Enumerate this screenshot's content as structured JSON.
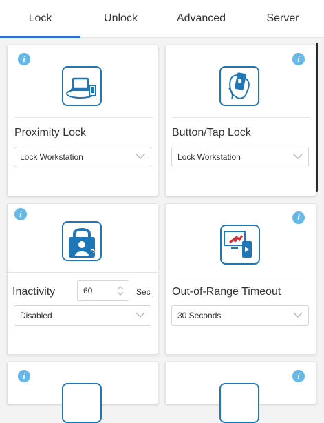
{
  "tabs": [
    {
      "label": "Lock",
      "active": true
    },
    {
      "label": "Unlock",
      "active": false
    },
    {
      "label": "Advanced",
      "active": false
    },
    {
      "label": "Server",
      "active": false
    }
  ],
  "cards": {
    "proximity": {
      "title": "Proximity Lock",
      "select_value": "Lock Workstation",
      "icon": "laptop-phone-icon"
    },
    "button_tap": {
      "title": "Button/Tap Lock",
      "select_value": "Lock Workstation",
      "icon": "hand-phone-icon"
    },
    "inactivity": {
      "title": "Inactivity",
      "input_value": "60",
      "unit": "Sec",
      "select_value": "Disabled",
      "icon": "user-padlock-icon"
    },
    "out_of_range": {
      "title": "Out-of-Range Timeout",
      "select_value": "30 Seconds",
      "icon": "monitor-phone-icon"
    }
  },
  "colors": {
    "accent": "#2f6fd6",
    "icon_blue": "#1f77b7",
    "info_blue": "#66b8e8"
  }
}
